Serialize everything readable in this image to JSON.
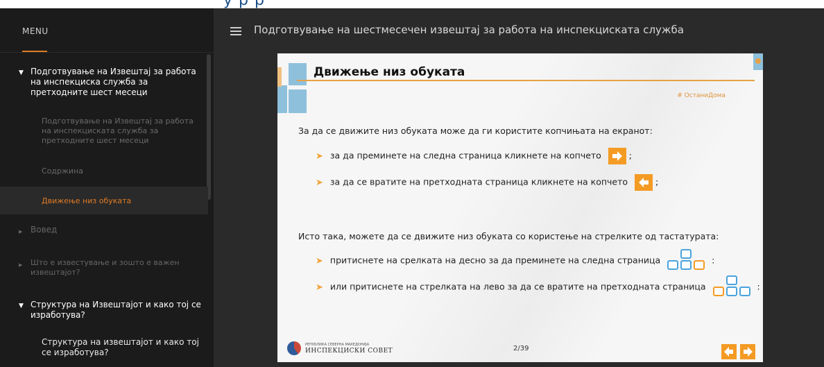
{
  "top_strip_text": "у  р                                   р",
  "sidebar": {
    "menu_label": "MENU",
    "items": [
      {
        "label": "Подготвување на Извештај за работа на инспекциска служба за претходните шест месеци",
        "expanded": true,
        "children": [
          {
            "label": "Подготвување на Извештај за работа на инспекциската служба за претходните шест месеци"
          },
          {
            "label": "Содржина"
          },
          {
            "label": "Движење низ обуката",
            "active": true
          }
        ]
      },
      {
        "label": "Вовед"
      },
      {
        "label": "Што е известување и зошто е важен извештајот?"
      },
      {
        "label": "Структура на Извештајот и како тој се изработува?",
        "expanded": true,
        "children": [
          {
            "label": "Структура на извештајот и како тој се изработува?"
          }
        ]
      }
    ]
  },
  "header": {
    "title": "Подготвување на шестмесечен извештај за работа на инспекциската служба"
  },
  "slide": {
    "title": "Движење низ обуката",
    "hashtag": "# ОстаниДома",
    "para1": "За да се движите низ обуката може да ги користите копчињата на екранот:",
    "bullet1": "за да преминете на следна страница кликнете на копчето",
    "bullet1_end": ";",
    "bullet2": "за да се вратите на претходната страница кликнете на копчето",
    "bullet2_end": ";",
    "para2": "Исто така, можете да се движите низ обуката со користење на стрелките од тастатурата:",
    "bullet3": "притиснете на срелката на десно за да преминете на следна страница",
    "bullet3_end": ":",
    "bullet4": "или притиснете на стрелката на лево за да се вратите на претходната страница",
    "bullet4_end": ":",
    "logo_small": "РЕПУБЛИКА СЕВЕРНА МАКЕДОНИЈА",
    "logo_big": "ИНСПЕКЦИСКИ СОВЕТ",
    "page": "2/39"
  },
  "colors": {
    "accent_orange": "#f49b24",
    "sidebar_bg": "#1b1b1b",
    "header_bg": "#2a2a2a",
    "deco_blue": "#8ec0dc",
    "key_blue": "#4aa3dd"
  }
}
